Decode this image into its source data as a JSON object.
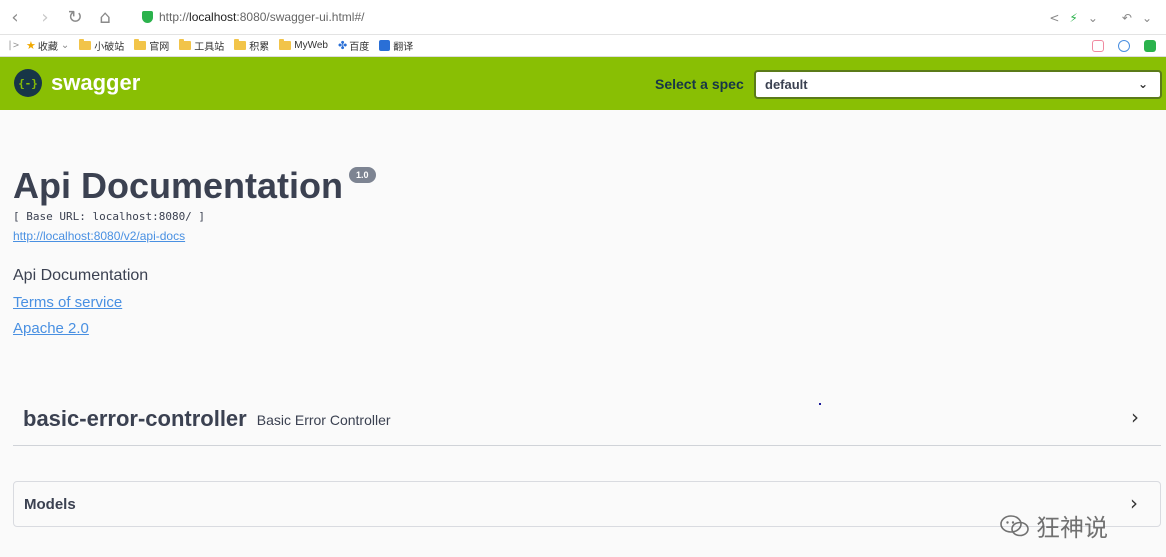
{
  "browser": {
    "url_prefix": "http://",
    "url_host": "localhost",
    "url_rest": ":8080/swagger-ui.html#/",
    "bookmarks": [
      "收藏",
      "小破站",
      "官网",
      "工具站",
      "积累",
      "MyWeb",
      "百度",
      "翻译"
    ]
  },
  "swagger": {
    "logo_text": "swagger",
    "logo_glyph": "{-}",
    "spec_label": "Select a spec",
    "spec_value": "default"
  },
  "info": {
    "title": "Api Documentation",
    "version": "1.0",
    "base_url": "[ Base URL: localhost:8080/ ]",
    "api_docs_link": "http://localhost:8080/v2/api-docs",
    "description": "Api Documentation",
    "terms": "Terms of service",
    "license": "Apache 2.0"
  },
  "controllers": [
    {
      "name": "basic-error-controller",
      "description": "Basic Error Controller"
    }
  ],
  "models": {
    "title": "Models"
  },
  "watermark": {
    "text": "狂神说"
  },
  "colors": {
    "topbar": "#89bf04",
    "link": "#4990e2",
    "text": "#3b4151"
  }
}
